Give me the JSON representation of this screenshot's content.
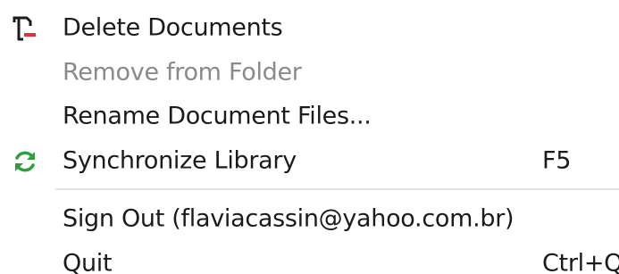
{
  "menu": {
    "items": [
      {
        "label": "Delete Documents",
        "shortcut": "",
        "icon": "delete-document-icon",
        "enabled": true
      },
      {
        "label": "Remove from Folder",
        "shortcut": "",
        "icon": "",
        "enabled": false
      },
      {
        "label": "Rename Document Files...",
        "shortcut": "",
        "icon": "",
        "enabled": true
      },
      {
        "label": "Synchronize Library",
        "shortcut": "F5",
        "icon": "sync-icon",
        "enabled": true
      },
      {
        "label": "Sign Out (flaviacassin@yahoo.com.br)",
        "shortcut": "",
        "icon": "",
        "enabled": true
      },
      {
        "label": "Quit",
        "shortcut": "Ctrl+Q",
        "icon": "",
        "enabled": true
      }
    ]
  },
  "colors": {
    "text": "#1b1b1b",
    "disabled_text": "#8a8a8a",
    "separator": "#e3e3e3",
    "sync_icon": "#2e9e3e",
    "delete_icon_accent": "#e0313b"
  }
}
